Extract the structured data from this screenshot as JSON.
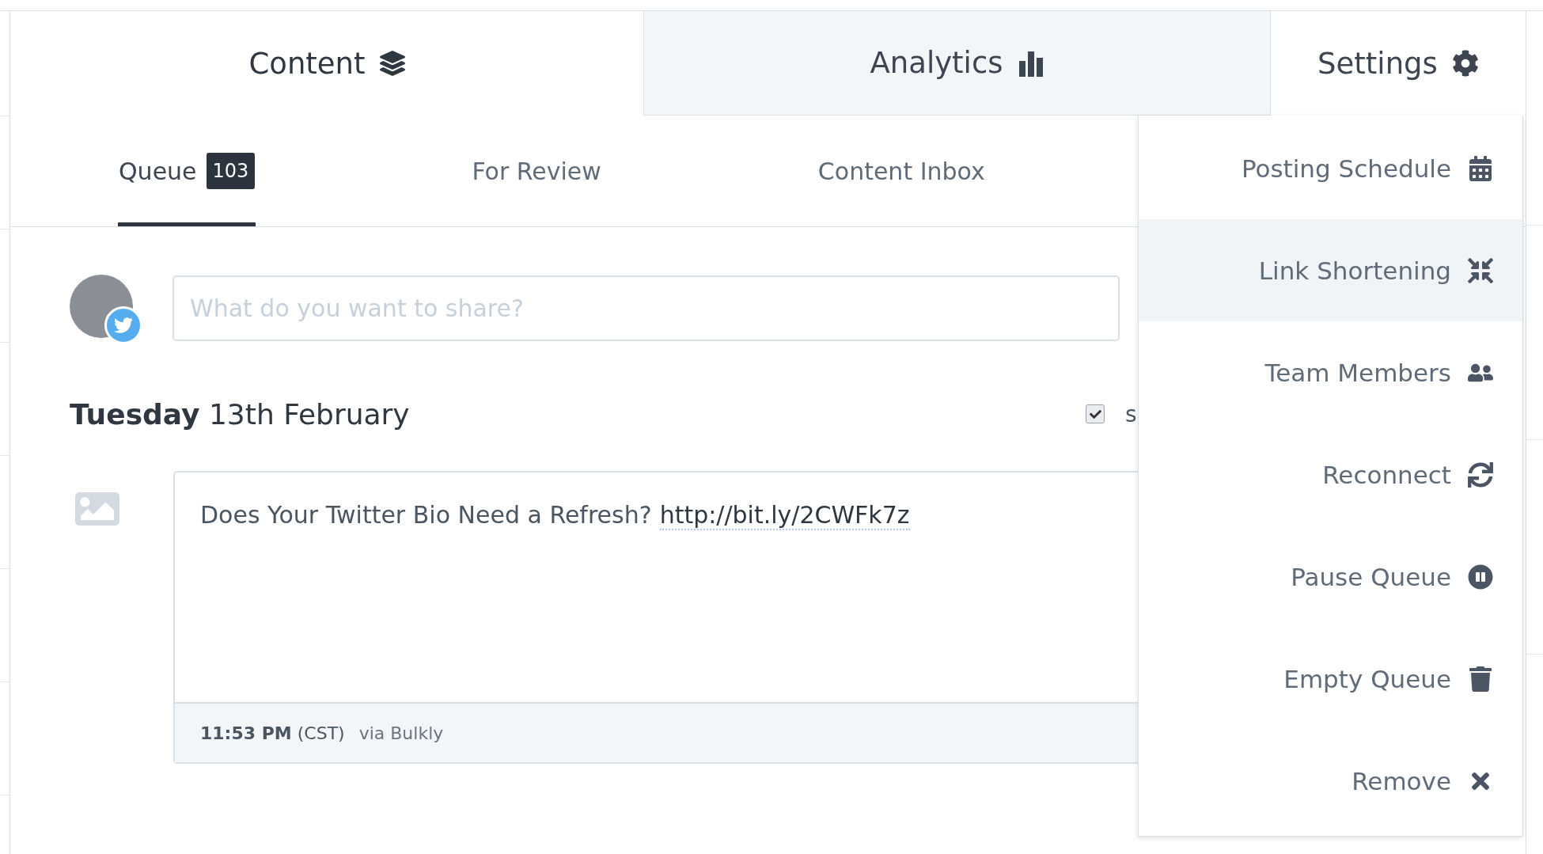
{
  "tabs": [
    {
      "label": "Content",
      "selected": true,
      "expanded": false
    },
    {
      "label": "Analytics",
      "selected": false,
      "expanded": false
    },
    {
      "label": "Settings",
      "selected": false,
      "expanded": true
    }
  ],
  "settings_menu": [
    {
      "label": "Posting Schedule",
      "selected": false
    },
    {
      "label": "Link Shortening",
      "selected": true
    },
    {
      "label": "Team Members",
      "selected": false
    },
    {
      "label": "Reconnect",
      "selected": false
    },
    {
      "label": "Pause Queue",
      "selected": false
    },
    {
      "label": "Empty Queue",
      "selected": false
    },
    {
      "label": "Remove",
      "selected": false
    }
  ],
  "subtabs": [
    {
      "label": "Queue",
      "badge": "103",
      "selected": true
    },
    {
      "label": "For Review",
      "selected": false
    },
    {
      "label": "Content Inbox",
      "selected": false
    }
  ],
  "composer": {
    "placeholder": "What do you want to share?"
  },
  "day": {
    "weekday": "Tuesday",
    "date": "13th February",
    "checkbox": {
      "checked": true,
      "label": "s"
    }
  },
  "post": {
    "text": "Does Your Twitter Bio Need a Refresh?",
    "link": "http://bit.ly/2CWFk7z",
    "time": "11:53 PM",
    "timezone": "(CST)",
    "source": "via Bulkly"
  }
}
